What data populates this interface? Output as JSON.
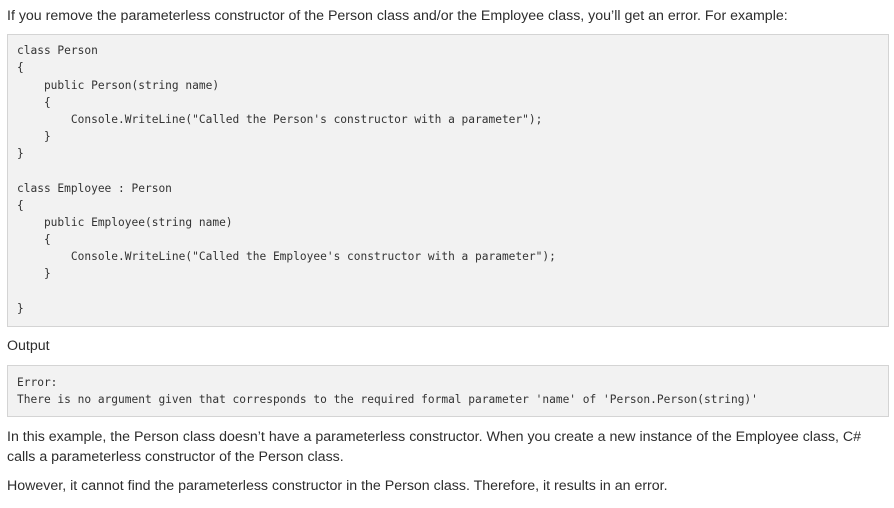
{
  "intro": "If you remove the parameterless constructor of the Person class and/or the Employee class, you’ll get an error. For example:",
  "code_example": {
    "lines": [
      "class Person",
      "{",
      "    public Person(string name)",
      "    {",
      "        Console.WriteLine(\"Called the Person's constructor with a parameter\");",
      "    }",
      "}",
      "class Employee : Person",
      "{",
      "    public Employee(string name)",
      "    {",
      "        Console.WriteLine(\"Called the Employee's constructor with a parameter\");",
      "    }",
      "}"
    ]
  },
  "output_label": "Output",
  "output": {
    "lines": [
      "Error:",
      "There is no argument given that corresponds to the required formal parameter 'name' of 'Person.Person(string)'"
    ]
  },
  "explanation": [
    "In this example, the Person class doesn’t have a parameterless constructor. When you create a new instance of the Employee class, C# calls a parameterless constructor of the Person class.",
    "However, it cannot find the parameterless constructor in the Person class. Therefore, it results in an error."
  ]
}
